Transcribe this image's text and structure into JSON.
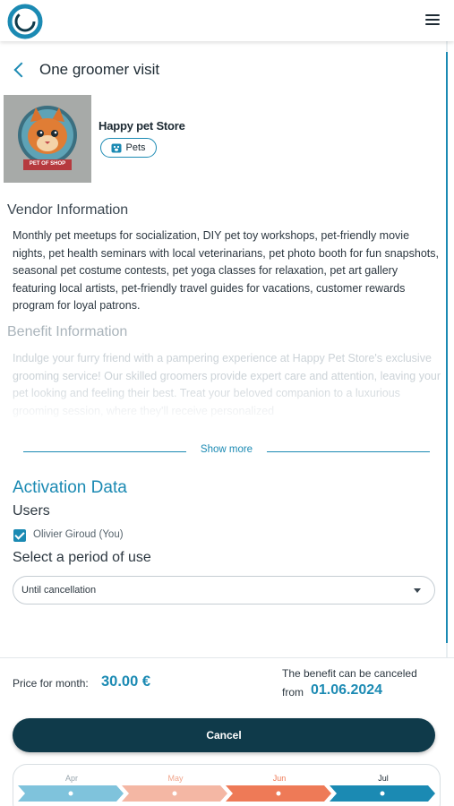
{
  "header": {
    "title": "One groomer visit"
  },
  "vendor": {
    "name": "Happy pet Store",
    "category": "Pets",
    "image_label": "PET OF SHOP"
  },
  "vendor_info": {
    "heading": "Vendor Information",
    "text": "Monthly pet meetups for socialization, DIY pet toy workshops, pet-friendly movie nights, pet health seminars with local veterinarians, pet photo booth for fun snapshots, seasonal pet costume contests, pet yoga classes for relaxation, pet art gallery featuring local artists, pet-friendly travel guides for vacations, customer rewards program for loyal patrons."
  },
  "benefit_info": {
    "heading": "Benefit Information",
    "text": "Indulge your furry friend with a pampering experience at Happy Pet Store's exclusive grooming service! Our skilled groomers provide expert care and attention, leaving your pet looking and feeling their best. Treat your beloved companion to a luxurious grooming session, where they'll receive personalized",
    "show_more": "Show more"
  },
  "activation": {
    "title": "Activation Data",
    "users_label": "Users",
    "user_name": "Olivier Giroud (You)",
    "period_label": "Select a period of use",
    "period_value": "Until cancellation"
  },
  "footer": {
    "price_label": "Price for month:",
    "price_value": "30.00 €",
    "cancel_note": "The benefit can be canceled",
    "from_label": "from",
    "from_date": "01.06.2024",
    "cancel_button": "Cancel"
  },
  "timeline": {
    "months": [
      "Apr",
      "May",
      "Jun",
      "Jul"
    ],
    "colors": [
      "#7fc3dc",
      "#f4b7a4",
      "#ee7a57",
      "#1b8ab3"
    ]
  },
  "colors": {
    "accent": "#1b8ab3",
    "primary_dark": "#0f3a4a"
  }
}
